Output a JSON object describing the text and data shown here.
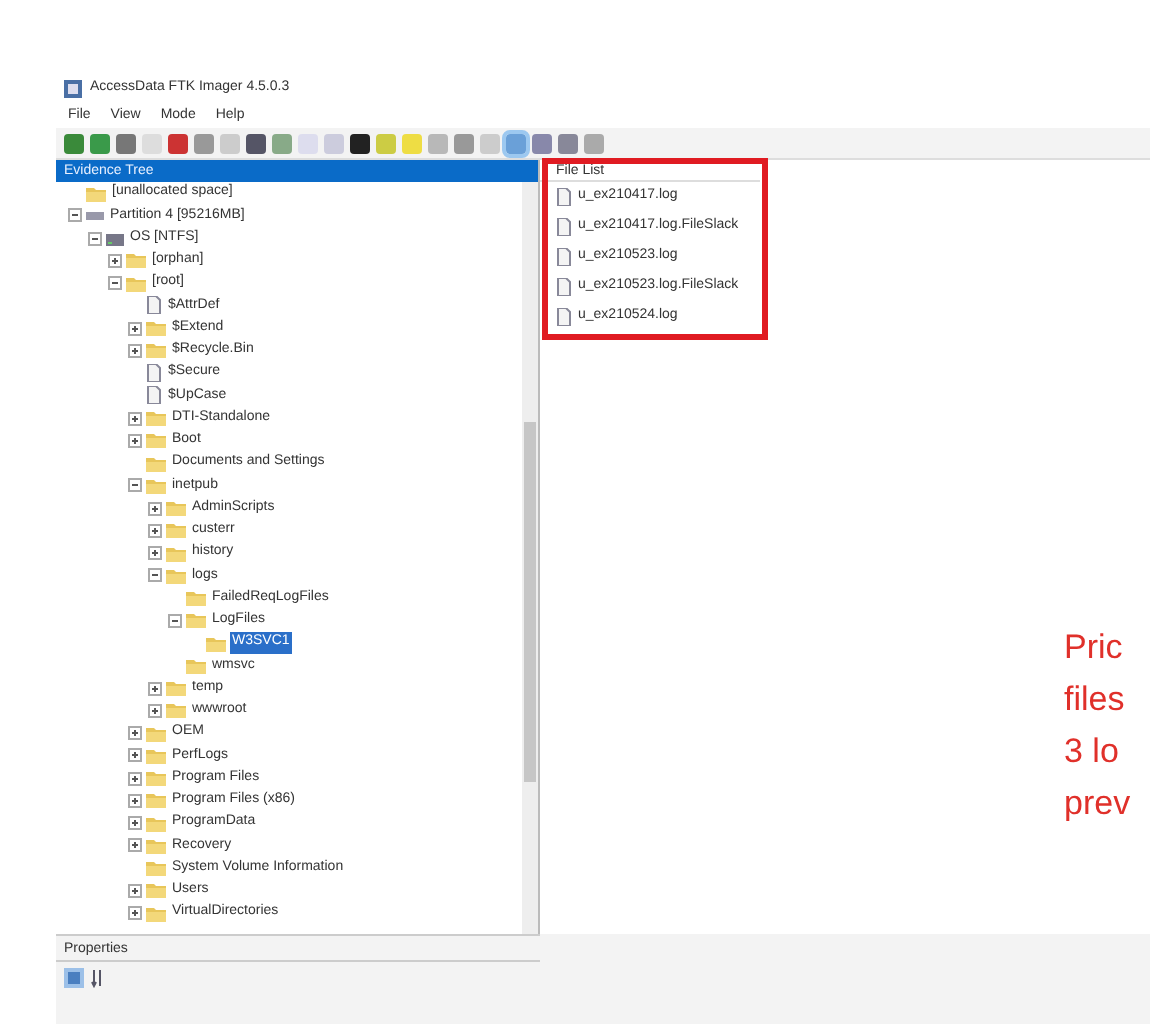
{
  "window": {
    "title": "AccessData FTK Imager 4.5.0.3"
  },
  "menu": [
    {
      "label": "File"
    },
    {
      "label": "View"
    },
    {
      "label": "Mode"
    },
    {
      "label": "Help"
    }
  ],
  "toolbar": [
    {
      "pressed": false
    },
    {
      "pressed": false
    },
    {
      "pressed": false
    },
    {
      "pressed": false
    },
    {
      "pressed": false
    },
    {
      "pressed": false
    },
    {
      "pressed": false
    },
    {
      "pressed": false
    },
    {
      "pressed": false
    },
    {
      "pressed": false
    },
    {
      "pressed": false
    },
    {
      "pressed": false
    },
    {
      "pressed": false
    },
    {
      "pressed": false
    },
    {
      "pressed": false
    },
    {
      "pressed": false
    },
    {
      "pressed": false
    },
    {
      "pressed": true
    },
    {
      "pressed": false
    },
    {
      "pressed": false
    },
    {
      "pressed": false
    }
  ],
  "evidence_tree": {
    "title": "Evidence Tree",
    "items": [
      {
        "label": "[unallocated space]",
        "kind": "folder",
        "selected": false
      },
      {
        "label": "Partition 4 [95216MB]",
        "kind": "partition",
        "selected": false,
        "expanded": true,
        "children": [
          {
            "label": "OS [NTFS]",
            "kind": "drive",
            "selected": false,
            "expanded": true,
            "children": [
              {
                "label": "[orphan]",
                "kind": "folder",
                "selected": false,
                "expanded": false
              },
              {
                "label": "[root]",
                "kind": "folder",
                "selected": false,
                "expanded": true,
                "children": [
                  {
                    "label": "$AttrDef",
                    "kind": "file",
                    "selected": false
                  },
                  {
                    "label": "$Extend",
                    "kind": "folder",
                    "selected": false,
                    "expanded": false
                  },
                  {
                    "label": "$Recycle.Bin",
                    "kind": "folder",
                    "selected": false,
                    "expanded": false
                  },
                  {
                    "label": "$Secure",
                    "kind": "file",
                    "selected": false
                  },
                  {
                    "label": "$UpCase",
                    "kind": "file",
                    "selected": false
                  },
                  {
                    "label": "DTI-Standalone",
                    "kind": "folder",
                    "selected": false,
                    "expanded": false
                  },
                  {
                    "label": "Boot",
                    "kind": "folder",
                    "selected": false,
                    "expanded": false
                  },
                  {
                    "label": "Documents and Settings",
                    "kind": "folder",
                    "selected": false
                  },
                  {
                    "label": "inetpub",
                    "kind": "folder",
                    "selected": false,
                    "expanded": true,
                    "children": [
                      {
                        "label": "AdminScripts",
                        "kind": "folder",
                        "selected": false,
                        "expanded": false
                      },
                      {
                        "label": "custerr",
                        "kind": "folder",
                        "selected": false,
                        "expanded": false
                      },
                      {
                        "label": "history",
                        "kind": "folder",
                        "selected": false,
                        "expanded": false
                      },
                      {
                        "label": "logs",
                        "kind": "folder",
                        "selected": false,
                        "expanded": true,
                        "children": [
                          {
                            "label": "FailedReqLogFiles",
                            "kind": "folder",
                            "selected": false
                          },
                          {
                            "label": "LogFiles",
                            "kind": "folder",
                            "selected": false,
                            "expanded": true,
                            "children": [
                              {
                                "label": "W3SVC1",
                                "kind": "folder",
                                "selected": true
                              }
                            ]
                          },
                          {
                            "label": "wmsvc",
                            "kind": "folder",
                            "selected": false
                          }
                        ]
                      },
                      {
                        "label": "temp",
                        "kind": "folder",
                        "selected": false,
                        "expanded": false
                      },
                      {
                        "label": "wwwroot",
                        "kind": "folder",
                        "selected": false,
                        "expanded": false
                      }
                    ]
                  },
                  {
                    "label": "OEM",
                    "kind": "folder",
                    "selected": false,
                    "expanded": false
                  },
                  {
                    "label": "PerfLogs",
                    "kind": "folder",
                    "selected": false,
                    "expanded": false
                  },
                  {
                    "label": "Program Files",
                    "kind": "folder",
                    "selected": false,
                    "expanded": false
                  },
                  {
                    "label": "Program Files (x86)",
                    "kind": "folder",
                    "selected": false,
                    "expanded": false
                  },
                  {
                    "label": "ProgramData",
                    "kind": "folder",
                    "selected": false,
                    "expanded": false
                  },
                  {
                    "label": "Recovery",
                    "kind": "folder",
                    "selected": false,
                    "expanded": false
                  },
                  {
                    "label": "System Volume Information",
                    "kind": "folder",
                    "selected": false
                  },
                  {
                    "label": "Users",
                    "kind": "folder",
                    "selected": false,
                    "expanded": false
                  },
                  {
                    "label": "VirtualDirectories",
                    "kind": "folder",
                    "selected": false,
                    "expanded": false
                  }
                ]
              }
            ]
          }
        ]
      }
    ]
  },
  "file_list": {
    "title": "File List",
    "items": [
      {
        "name": "u_ex210417.log"
      },
      {
        "name": "u_ex210417.log.FileSlack"
      },
      {
        "name": "u_ex210523.log"
      },
      {
        "name": "u_ex210523.log.FileSlack"
      },
      {
        "name": "u_ex210524.log"
      }
    ]
  },
  "properties": {
    "title": "Properties"
  },
  "side_text": [
    "Pric",
    "files",
    "3 lo",
    "prev"
  ]
}
